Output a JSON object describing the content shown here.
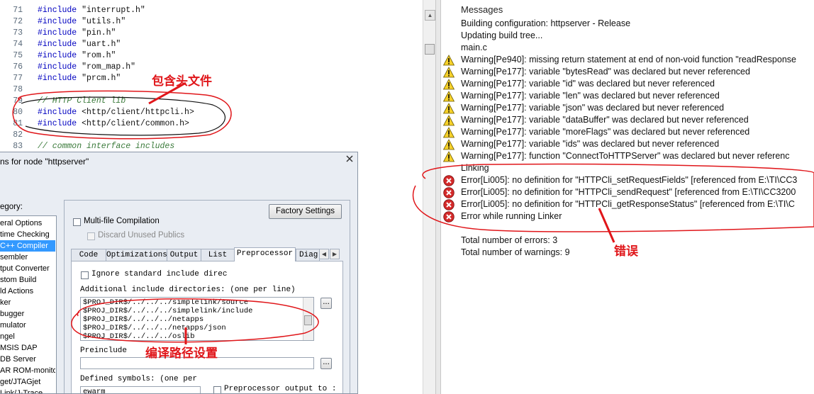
{
  "editor": {
    "lines": [
      {
        "n": "71",
        "kw": "#include",
        "arg": " \"interrupt.h\""
      },
      {
        "n": "72",
        "kw": "#include",
        "arg": " \"utils.h\""
      },
      {
        "n": "73",
        "kw": "#include",
        "arg": " \"pin.h\""
      },
      {
        "n": "74",
        "kw": "#include",
        "arg": " \"uart.h\""
      },
      {
        "n": "75",
        "kw": "#include",
        "arg": " \"rom.h\""
      },
      {
        "n": "76",
        "kw": "#include",
        "arg": " \"rom_map.h\""
      },
      {
        "n": "77",
        "kw": "#include",
        "arg": " \"prcm.h\""
      },
      {
        "n": "78",
        "kw": "",
        "arg": ""
      },
      {
        "n": "79",
        "comment": "// HTTP Client lib"
      },
      {
        "n": "80",
        "kw": "#include",
        "arg": " <http/client/httpcli.h>"
      },
      {
        "n": "81",
        "kw": "#include",
        "arg": " <http/client/common.h>"
      },
      {
        "n": "82",
        "kw": "",
        "arg": ""
      },
      {
        "n": "83",
        "comment": "// common interface includes"
      }
    ]
  },
  "messages": {
    "title": "Messages",
    "items": [
      {
        "type": "info",
        "text": "Building configuration: httpserver - Release"
      },
      {
        "type": "info",
        "text": "Updating build tree..."
      },
      {
        "type": "info",
        "text": "main.c"
      },
      {
        "type": "warning",
        "text": "Warning[Pe940]: missing return statement at end of non-void function \"readResponse"
      },
      {
        "type": "warning",
        "text": "Warning[Pe177]: variable \"bytesRead\" was declared but never referenced"
      },
      {
        "type": "warning",
        "text": "Warning[Pe177]: variable \"id\" was declared but never referenced"
      },
      {
        "type": "warning",
        "text": "Warning[Pe177]: variable \"len\" was declared but never referenced"
      },
      {
        "type": "warning",
        "text": "Warning[Pe177]: variable \"json\" was declared but never referenced"
      },
      {
        "type": "warning",
        "text": "Warning[Pe177]: variable \"dataBuffer\" was declared but never referenced"
      },
      {
        "type": "warning",
        "text": "Warning[Pe177]: variable \"moreFlags\" was declared but never referenced"
      },
      {
        "type": "warning",
        "text": "Warning[Pe177]: variable \"ids\" was declared but never referenced"
      },
      {
        "type": "warning",
        "text": "Warning[Pe177]: function \"ConnectToHTTPServer\" was declared but never referenc"
      },
      {
        "type": "info",
        "text": "Linking"
      },
      {
        "type": "error",
        "text": "Error[Li005]: no definition for \"HTTPCli_setRequestFields\" [referenced from E:\\TI\\CC3"
      },
      {
        "type": "error",
        "text": "Error[Li005]: no definition for \"HTTPCli_sendRequest\" [referenced from E:\\TI\\CC3200"
      },
      {
        "type": "error",
        "text": "Error[Li005]: no definition for \"HTTPCli_getResponseStatus\" [referenced from E:\\TI\\C"
      },
      {
        "type": "error",
        "text": "Error while running Linker"
      }
    ],
    "total_errors": "Total number of errors: 3",
    "total_warnings": "Total number of warnings: 9"
  },
  "dialog": {
    "title": "ns for node \"httpserver\"",
    "category_label": "egory:",
    "categories": [
      {
        "label": "eral Options",
        "selected": false
      },
      {
        "label": "time Checking",
        "selected": false
      },
      {
        "label": "C++ Compiler",
        "selected": true
      },
      {
        "label": "sembler",
        "selected": false
      },
      {
        "label": "tput Converter",
        "selected": false
      },
      {
        "label": "stom Build",
        "selected": false
      },
      {
        "label": "ld Actions",
        "selected": false
      },
      {
        "label": "ker",
        "selected": false
      },
      {
        "label": "bugger",
        "selected": false
      },
      {
        "label": "mulator",
        "selected": false
      },
      {
        "label": "ngel",
        "selected": false
      },
      {
        "label": "MSIS DAP",
        "selected": false
      },
      {
        "label": "DB Server",
        "selected": false
      },
      {
        "label": "AR ROM-monitor",
        "selected": false
      },
      {
        "label": "get/JTAGjet",
        "selected": false
      },
      {
        "label": "Link/J-Trace",
        "selected": false
      }
    ],
    "factory_settings": "Factory Settings",
    "multifile": "Multi-file Compilation",
    "discard_unused": "Discard Unused Publics",
    "tabs": [
      "Code",
      "Optimizations",
      "Output",
      "List",
      "Preprocessor",
      "Diag"
    ],
    "active_tab": "Preprocessor",
    "ignore_std": "Ignore standard include direc",
    "additional_label": "Additional include directories: (one per line)",
    "include_dirs": [
      "$PROJ_DIR$/../../../simplelink/source",
      "$PROJ_DIR$/../../../simplelink/include",
      "$PROJ_DIR$/../../../netapps",
      "$PROJ_DIR$/../../../netapps/json",
      "$PROJ_DIR$/../../../oslib"
    ],
    "browse_label": "...",
    "preinclude_label": "Preinclude",
    "defined_symbols_label": "Defined symbols: (one per",
    "defined_symbols_value": "ewarm",
    "preproc_output": "Preprocessor output to :"
  },
  "annotations": {
    "include_headers": "包含头文件",
    "errors": "错误",
    "compile_path": "编译路径设置"
  },
  "colors": {
    "keyword": "#0000c0",
    "comment": "#3a7a3a",
    "annotation": "#e0161a",
    "selection": "#3399ff"
  }
}
